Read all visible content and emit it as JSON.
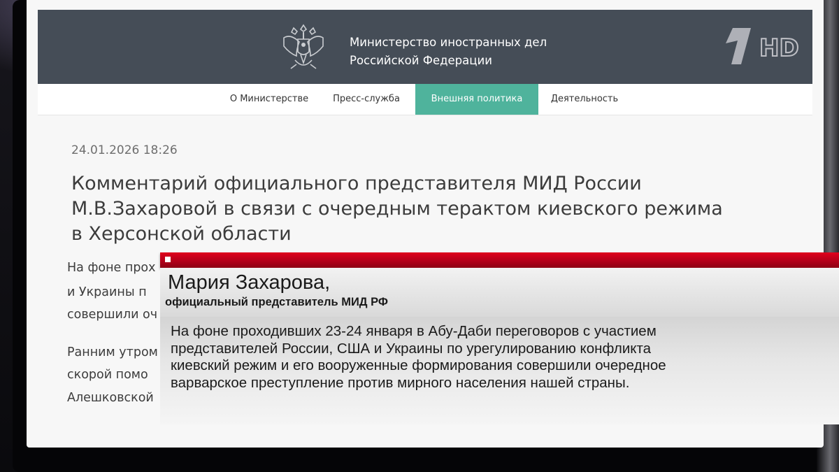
{
  "site": {
    "ministry_title": [
      "Министерство иностранных дел",
      "Российской Федерации"
    ],
    "emblem_icon": "double-headed-eagle-icon",
    "nav": [
      {
        "label": "О Министерстве",
        "active": false
      },
      {
        "label": "Пресс-служба",
        "active": false
      },
      {
        "label": "Внешняя политика",
        "active": true
      },
      {
        "label": "Деятельность",
        "active": false
      }
    ],
    "colors": {
      "header": "#454d57",
      "nav_active": "#4fb39c"
    }
  },
  "article": {
    "date": "24.01.2026 18:26",
    "headline": [
      "Комментарий официального представителя МИД России",
      "М.В.Захаровой в связи с очередным терактом киевского режима",
      "в Херсонской области"
    ],
    "body_fragments": [
      "На фоне прох",
      "и Украины п",
      "совершили оч",
      "Ранним утром",
      "скорой помо",
      "Алешковской"
    ]
  },
  "lower_third": {
    "name": "Мария Захарова,",
    "role": "официальный представитель МИД РФ",
    "quote": [
      "На фоне проходивших 23-24 января в Абу-Даби переговоров с участием",
      "представителей России, США и Украины по урегулированию конфликта",
      "киевский режим и его вооруженные формирования совершили очередное",
      "варварское преступление против мирного населения нашей страны."
    ],
    "accent_color": "#d0001a"
  },
  "channel": {
    "hd_label": "HD",
    "logo_icon": "channel-one-logo-icon"
  }
}
